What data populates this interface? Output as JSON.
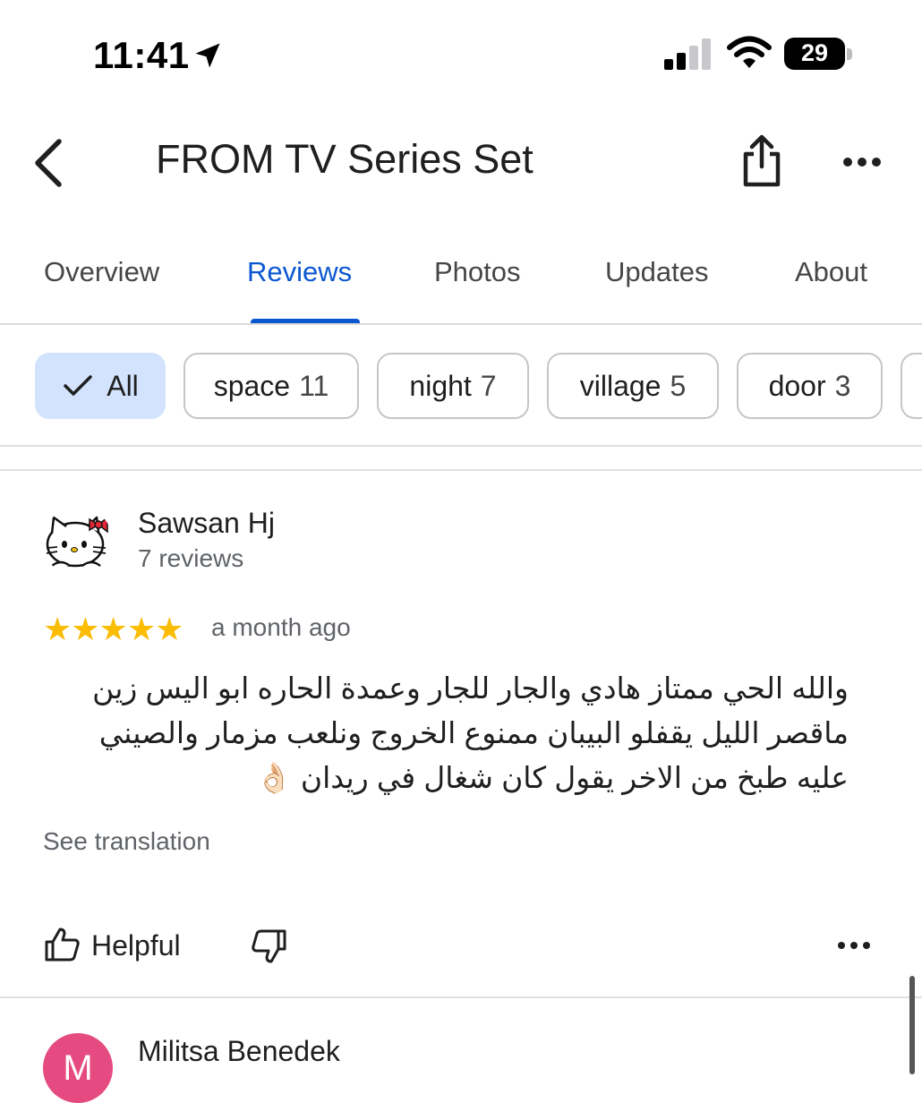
{
  "status_bar": {
    "time": "11:41",
    "battery": "29",
    "icons": [
      "location-arrow-icon",
      "cellular-signal-icon",
      "wifi-icon",
      "battery-icon"
    ]
  },
  "header": {
    "title": "FROM TV Series Set",
    "icons": [
      "back-chevron-icon",
      "share-icon",
      "more-horizontal-icon"
    ]
  },
  "tabs": [
    {
      "label": "Overview",
      "active": false
    },
    {
      "label": "Reviews",
      "active": true
    },
    {
      "label": "Photos",
      "active": false
    },
    {
      "label": "Updates",
      "active": false
    },
    {
      "label": "About",
      "active": false
    }
  ],
  "filter_chips": [
    {
      "label": "All",
      "count": "",
      "selected": true
    },
    {
      "label": "space",
      "count": "11",
      "selected": false
    },
    {
      "label": "night",
      "count": "7",
      "selected": false
    },
    {
      "label": "village",
      "count": "5",
      "selected": false
    },
    {
      "label": "door",
      "count": "3",
      "selected": false
    }
  ],
  "reviews": [
    {
      "author": "Sawsan Hj",
      "meta": "7 reviews",
      "rating": 5,
      "stars": "★★★★★",
      "time": "a month ago",
      "text": "والله الحي ممتاز هادي والجار للجار وعمدة الحاره ابو اليس زين ماقصر الليل يقفلو البيبان ممنوع الخروج ونلعب مزمار والصيني عليه طبخ من الاخر يقول كان شغال في ريدان 👌🏻",
      "see_translation": "See translation",
      "helpful_label": "Helpful"
    },
    {
      "author": "Militsa Benedek",
      "avatar_letter": "M"
    }
  ],
  "colors": {
    "accent": "#0b57d0",
    "chip_selected_bg": "#d3e3fd",
    "star": "#fbbc04",
    "avatar2_bg": "#e54b80"
  }
}
